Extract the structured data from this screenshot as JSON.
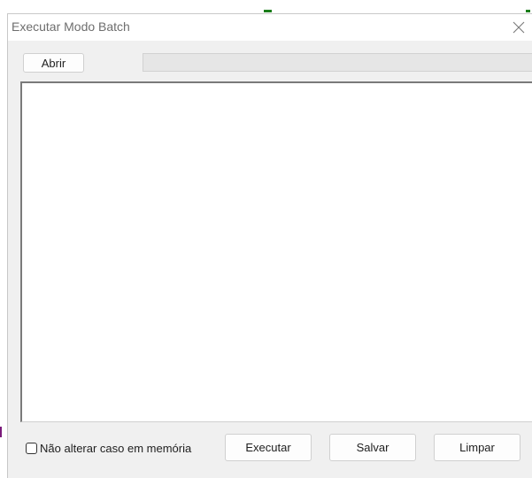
{
  "window": {
    "title": "Executar Modo Batch"
  },
  "toolbar": {
    "open_label": "Abrir",
    "progress_value": 0
  },
  "editor": {
    "content": ""
  },
  "footer": {
    "checkbox_label": "Não alterar caso em memória",
    "checkbox_checked": false,
    "execute_label": "Executar",
    "save_label": "Salvar",
    "clear_label": "Limpar"
  },
  "icons": {
    "close": "close-icon"
  },
  "colors": {
    "window_bg": "#f0f0f0",
    "title_text": "#6e6e6e",
    "artifact_green": "#1a7d1a"
  }
}
